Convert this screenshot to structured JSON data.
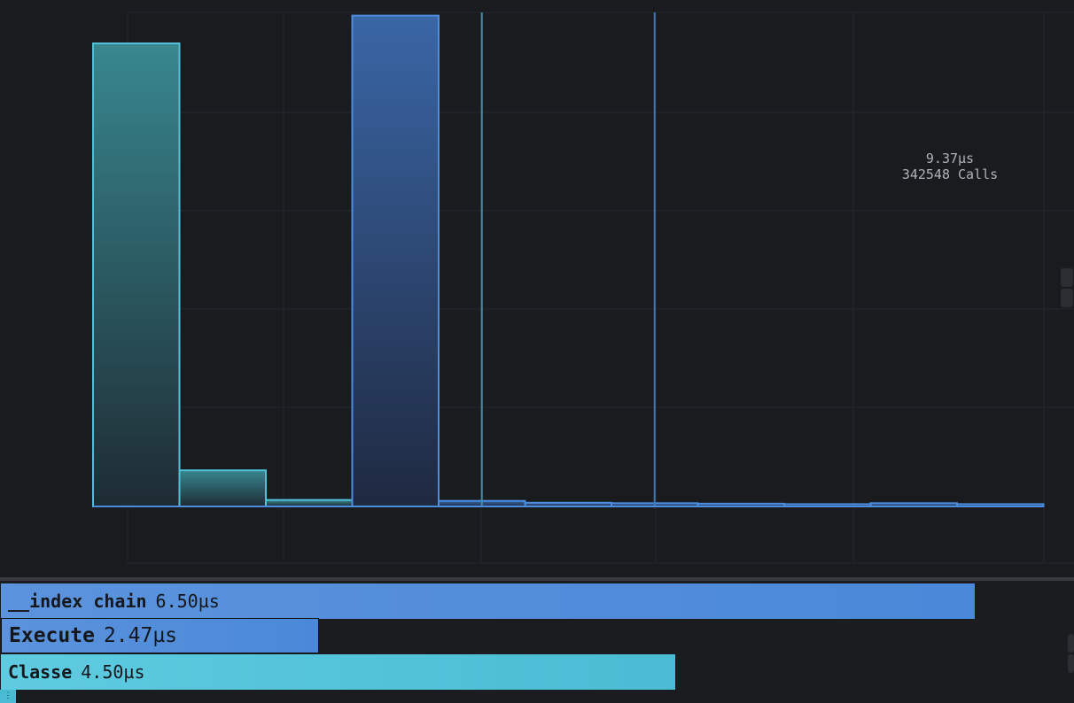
{
  "chart_data": {
    "type": "bar",
    "bins": [
      {
        "start": 0,
        "end": 1,
        "count": 1.0,
        "series": "low"
      },
      {
        "start": 1,
        "end": 2,
        "count": 0.078,
        "series": "low"
      },
      {
        "start": 2,
        "end": 3,
        "count": 0.014,
        "series": "low"
      },
      {
        "start": 3,
        "end": 4,
        "count": 1.06,
        "series": "high"
      },
      {
        "start": 4,
        "end": 5,
        "count": 0.012,
        "series": "high"
      },
      {
        "start": 5,
        "end": 6,
        "count": 0.008,
        "series": "high"
      },
      {
        "start": 6,
        "end": 7,
        "count": 0.007,
        "series": "high"
      },
      {
        "start": 7,
        "end": 8,
        "count": 0.006,
        "series": "high"
      },
      {
        "start": 8,
        "end": 9,
        "count": 0.005,
        "series": "high"
      },
      {
        "start": 9,
        "end": 10,
        "count": 0.007,
        "series": "high"
      },
      {
        "start": 10,
        "end": 11,
        "count": 0.005,
        "series": "high"
      },
      {
        "start": 11,
        "end": 10.95,
        "count": 0.003,
        "series": "high"
      }
    ],
    "markers": [
      {
        "x": 4.5,
        "color": "#3d8fa8"
      },
      {
        "x": 6.5,
        "color": "#3f78b8"
      }
    ],
    "grid": true,
    "tooltip": {
      "time": "9.37µs",
      "calls": "342548 Calls"
    },
    "colors": {
      "low_top": "#38878f",
      "low_bottom": "#1e2b33",
      "low_stroke": "#52c0d8",
      "high_top": "#3a66a6",
      "high_bottom": "#1f2940",
      "high_stroke": "#4b8ee0"
    }
  },
  "zones": [
    {
      "name": "__index chain",
      "time": "6.50µs"
    },
    {
      "name": "Execute",
      "time": "2.47µs"
    },
    {
      "name": "Classe",
      "time": "4.50µs"
    }
  ]
}
